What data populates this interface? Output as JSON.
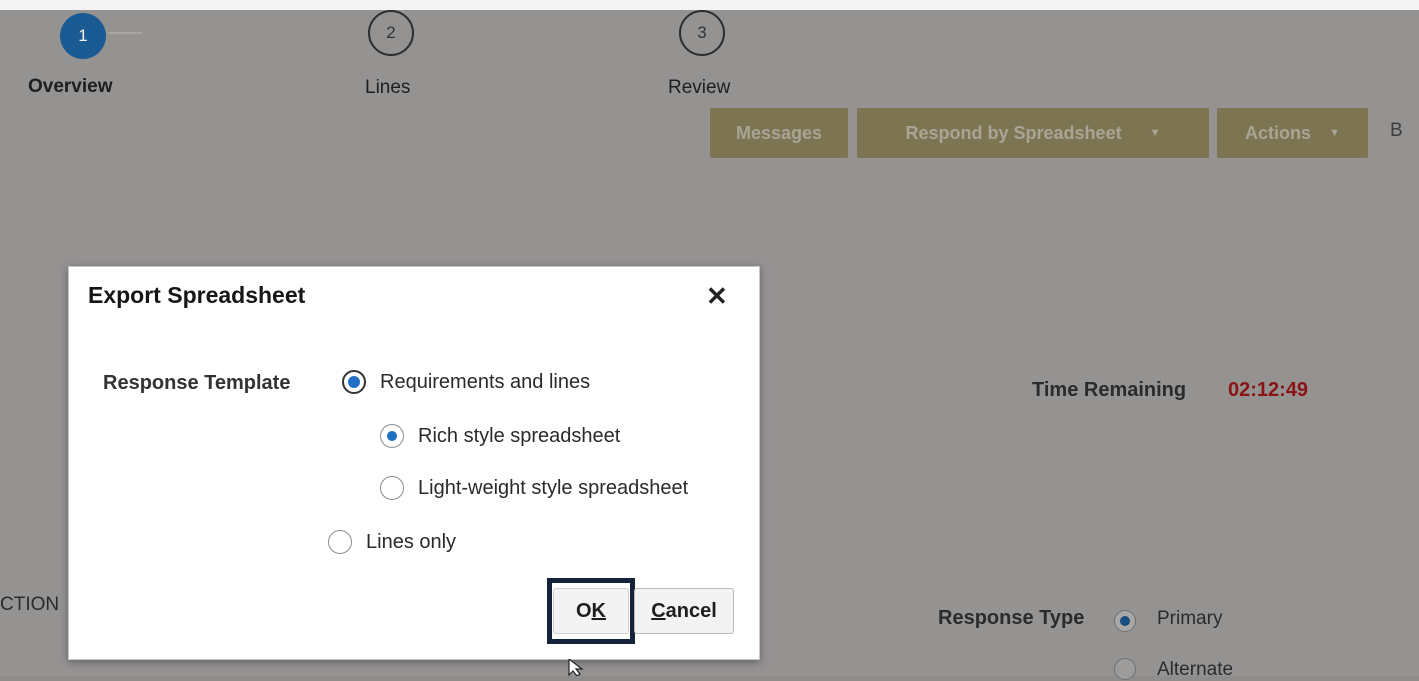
{
  "train": {
    "stops": [
      {
        "number": "1",
        "label": "Overview"
      },
      {
        "number": "2",
        "label": "Lines"
      },
      {
        "number": "3",
        "label": "Review"
      }
    ]
  },
  "toolbar": {
    "messages_label": "Messages",
    "respond_label": "Respond by Spreadsheet",
    "actions_label": "Actions",
    "cut_label": "B"
  },
  "page": {
    "time_remaining_label": "Time Remaining",
    "time_remaining_value": "02:12:49",
    "section_fragment": "CTION",
    "response_type_label": "Response Type",
    "response_type_options": [
      "Primary",
      "Alternate"
    ]
  },
  "dialog": {
    "title": "Export Spreadsheet",
    "field_label": "Response Template",
    "options": {
      "requirements": "Requirements and lines",
      "rich": "Rich style spreadsheet",
      "light": "Light-weight style spreadsheet",
      "lines_only": "Lines only"
    },
    "ok_label": "OK",
    "ok_access_key": "K",
    "cancel_label": "Cancel",
    "cancel_access_key": "C"
  },
  "colors": {
    "active_step": "#1a5b93",
    "toolbar_button": "#7d7452",
    "time_value": "#8a1414",
    "radio_selected": "#1f6fc4",
    "focus_ring": "#14233a"
  }
}
